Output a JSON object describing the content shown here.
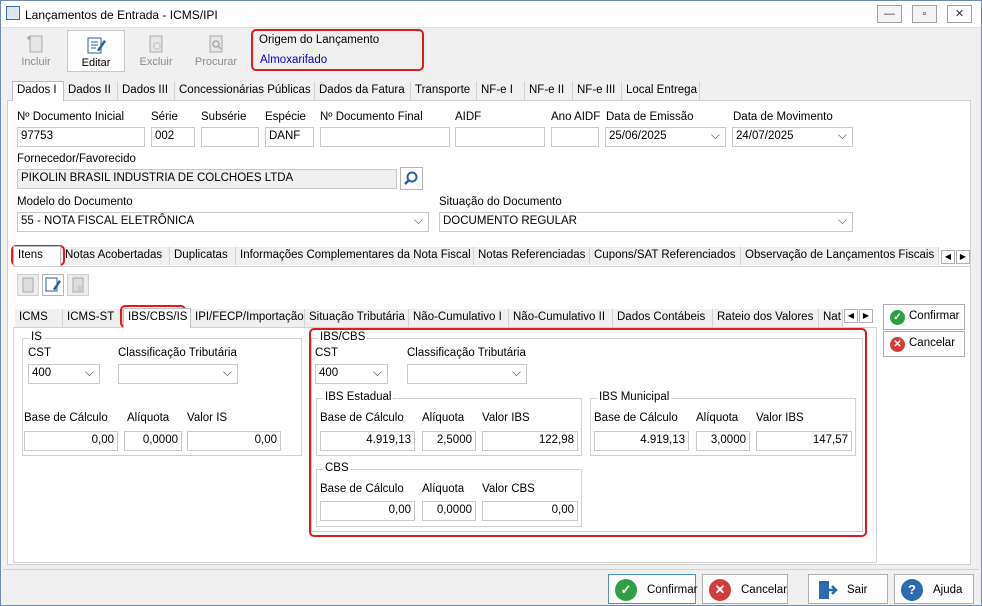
{
  "window": {
    "title": "Lançamentos de Entrada - ICMS/IPI"
  },
  "toolbar": {
    "incluir": "Incluir",
    "editar": "Editar",
    "excluir": "Excluir",
    "procurar": "Procurar"
  },
  "origem": {
    "label": "Origem do Lançamento",
    "value": "Almoxarifado"
  },
  "top_tabs": [
    "Dados I",
    "Dados II",
    "Dados III",
    "Concessionárias Públicas",
    "Dados da Fatura",
    "Transporte",
    "NF-e I",
    "NF-e II",
    "NF-e III",
    "Local Entrega"
  ],
  "form": {
    "doc_inicial_label": "Nº Documento Inicial",
    "doc_inicial": "97753",
    "serie_label": "Série",
    "serie": "002",
    "subserie_label": "Subsérie",
    "subserie": "",
    "especie_label": "Espécie",
    "especie": "DANF",
    "doc_final_label": "Nº Documento Final",
    "doc_final": "",
    "aidf_label": "AIDF",
    "aidf": "",
    "ano_aidf_label": "Ano AIDF",
    "ano_aidf": "",
    "emissao_label": "Data de Emissão",
    "emissao": "25/06/2025",
    "movimento_label": "Data de Movimento",
    "movimento": "24/07/2025",
    "fornecedor_label": "Fornecedor/Favorecido",
    "fornecedor": "PIKOLIN BRASIL INDUSTRIA DE COLCHOES LTDA",
    "modelo_label": "Modelo do Documento",
    "modelo": "55 - NOTA FISCAL ELETRÔNICA",
    "situacao_label": "Situação do Documento",
    "situacao": "DOCUMENTO REGULAR"
  },
  "mid_tabs": [
    "Itens",
    "Notas Acobertadas",
    "Duplicatas",
    "Informações Complementares da Nota Fiscal",
    "Notas Referenciadas",
    "Cupons/SAT Referenciados",
    "Observação de Lançamentos Fiscais (C"
  ],
  "item_tabs": [
    "ICMS",
    "ICMS-ST",
    "IBS/CBS/IS",
    "IPI/FECP/Importação",
    "Situação Tributária",
    "Não-Cumulativo I",
    "Não-Cumulativo II",
    "Dados Contábeis",
    "Rateio dos Valores",
    "Nat"
  ],
  "is": {
    "title": "IS",
    "cst_label": "CST",
    "cst": "400",
    "class_label": "Classificação Tributária",
    "class": "",
    "base_label": "Base de Cálculo",
    "base": "0,00",
    "aliq_label": "Alíquota",
    "aliq": "0,0000",
    "valor_label": "Valor IS",
    "valor": "0,00"
  },
  "ibscbs": {
    "title": "IBS/CBS",
    "cst_label": "CST",
    "cst": "400",
    "class_label": "Classificação Tributária",
    "class": "",
    "estadual": {
      "title": "IBS Estadual",
      "base_label": "Base de Cálculo",
      "base": "4.919,13",
      "aliq_label": "Alíquota",
      "aliq": "2,5000",
      "valor_label": "Valor IBS",
      "valor": "122,98"
    },
    "municipal": {
      "title": "IBS Municipal",
      "base_label": "Base de Cálculo",
      "base": "4.919,13",
      "aliq_label": "Alíquota",
      "aliq": "3,0000",
      "valor_label": "Valor IBS",
      "valor": "147,57"
    },
    "cbs": {
      "title": "CBS",
      "base_label": "Base de Cálculo",
      "base": "0,00",
      "aliq_label": "Alíquota",
      "aliq": "0,0000",
      "valor_label": "Valor CBS",
      "valor": "0,00"
    }
  },
  "side_buttons": {
    "confirmar": "Confirmar",
    "cancelar": "Cancelar"
  },
  "bottom_buttons": {
    "confirmar": "Confirmar",
    "cancelar": "Cancelar",
    "sair": "Sair",
    "ajuda": "Ajuda"
  },
  "colors": {
    "accent": "#0000cc",
    "highlight": "#e01b1b",
    "green": "#2ea043",
    "red": "#d43c3c",
    "blue": "#2b6cb0"
  }
}
